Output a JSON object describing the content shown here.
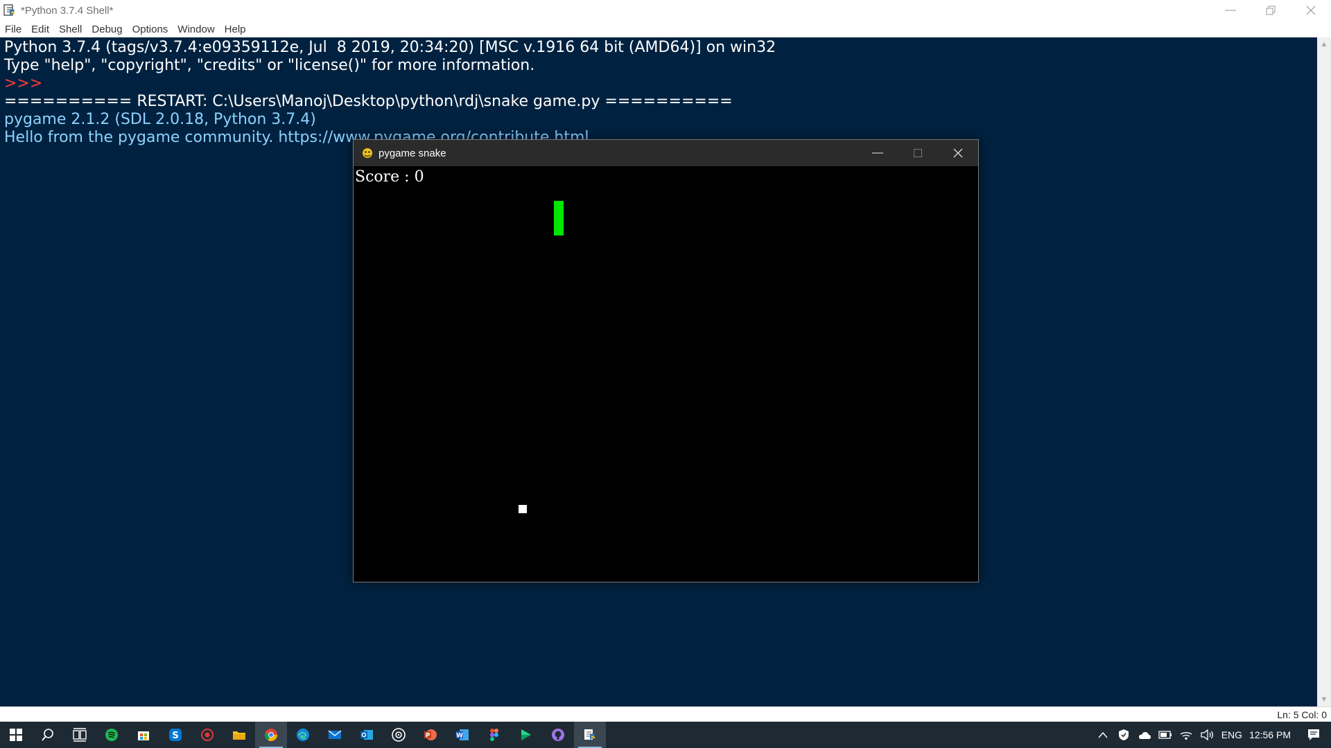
{
  "idle": {
    "title": "*Python 3.7.4 Shell*",
    "menus": [
      "File",
      "Edit",
      "Shell",
      "Debug",
      "Options",
      "Window",
      "Help"
    ],
    "shell_lines": [
      {
        "text": "Python 3.7.4 (tags/v3.7.4:e09359112e, Jul  8 2019, 20:34:20) [MSC v.1916 64 bit (AMD64)] on win32",
        "color": "#ffffff"
      },
      {
        "text": "Type \"help\", \"copyright\", \"credits\" or \"license()\" for more information.",
        "color": "#ffffff"
      },
      {
        "text": ">>> ",
        "color": "#ff3b3b"
      },
      {
        "text": "========== RESTART: C:\\Users\\Manoj\\Desktop\\python\\rdj\\snake game.py ==========",
        "color": "#ffffff"
      },
      {
        "text": "pygame 2.1.2 (SDL 2.0.18, Python 3.7.4)",
        "color": "#8ed2ff"
      },
      {
        "text": "Hello from the pygame community. https://www.pygame.org/contribute.html",
        "color": "#8ed2ff"
      }
    ],
    "status": "Ln: 5   Col: 0",
    "colors": {
      "shell_bg": "#002240",
      "prompt": "#ff3b3b",
      "output": "#8ed2ff"
    }
  },
  "pygame_window": {
    "title": "pygame snake",
    "score_text": "Score : 0",
    "score": 0,
    "colors": {
      "snake": "#00e600",
      "food": "#ffffff",
      "background": "#000000"
    }
  },
  "taskbar": {
    "apps": [
      "start-icon",
      "search-icon",
      "task-view-icon",
      "spotify-icon",
      "store-icon",
      "skype-icon",
      "recorder-icon",
      "file-explorer-icon",
      "chrome-icon",
      "edge-icon",
      "mail-icon",
      "outlook-icon",
      "media-player-icon",
      "powerpoint-icon",
      "word-icon",
      "figma-icon",
      "pycharm-icon",
      "github-icon",
      "idle-icon"
    ],
    "tray": {
      "language": "ENG",
      "time": "12:56 PM"
    }
  }
}
